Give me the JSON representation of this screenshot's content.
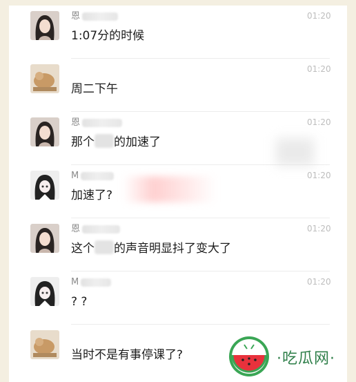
{
  "messages": [
    {
      "sender": "恩",
      "time": "01:20",
      "text": "1:07分的时候",
      "avatar": "avatar-girl-icon"
    },
    {
      "sender": "",
      "time": "01:20",
      "text": "周二下午",
      "avatar": "avatar-cat-icon"
    },
    {
      "sender": "恩",
      "time": "01:20",
      "text_before": "那个",
      "text_after": "的加速了",
      "avatar": "avatar-girl-icon"
    },
    {
      "sender": "M",
      "time": "01:20",
      "text": "加速了?",
      "avatar": "avatar-anime-icon"
    },
    {
      "sender": "恩",
      "time": "01:20",
      "text_before": "这个",
      "text_after": "的声音明显抖了变大了",
      "avatar": "avatar-girl-icon"
    },
    {
      "sender": "M",
      "time": "01:20",
      "text": "? ?",
      "avatar": "avatar-anime-icon"
    },
    {
      "sender": "",
      "time": "",
      "text": "当时不是有事停课了?",
      "avatar": "avatar-cat-icon"
    }
  ],
  "watermark": {
    "text": "·吃瓜网·"
  },
  "colors": {
    "accent": "#2f7f4a",
    "background": "#f4efe1"
  }
}
